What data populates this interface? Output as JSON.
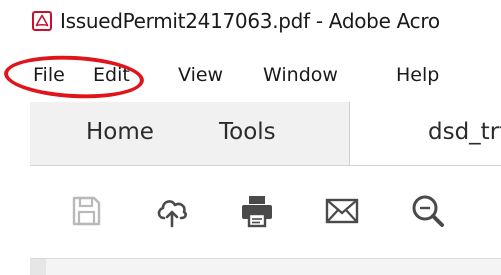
{
  "window": {
    "title": "IssuedPermit2417063.pdf - Adobe Acro",
    "app_icon": "adobe-acrobat-icon",
    "accent_color": "#c8102e"
  },
  "menubar": {
    "items": [
      {
        "label": "File"
      },
      {
        "label": "Edit"
      },
      {
        "label": "View"
      },
      {
        "label": "Window"
      },
      {
        "label": "Help"
      }
    ]
  },
  "annotation": {
    "shape": "ellipse",
    "color": "#e0141b",
    "target": "File"
  },
  "tabs": [
    {
      "label": "Home"
    },
    {
      "label": "Tools"
    },
    {
      "label": "dsd_trt_"
    }
  ],
  "toolbar": {
    "icons": [
      {
        "name": "save-icon",
        "enabled": false
      },
      {
        "name": "cloud-upload-icon",
        "enabled": true
      },
      {
        "name": "print-icon",
        "enabled": true
      },
      {
        "name": "email-icon",
        "enabled": true
      },
      {
        "name": "zoom-out-icon",
        "enabled": true
      }
    ]
  }
}
